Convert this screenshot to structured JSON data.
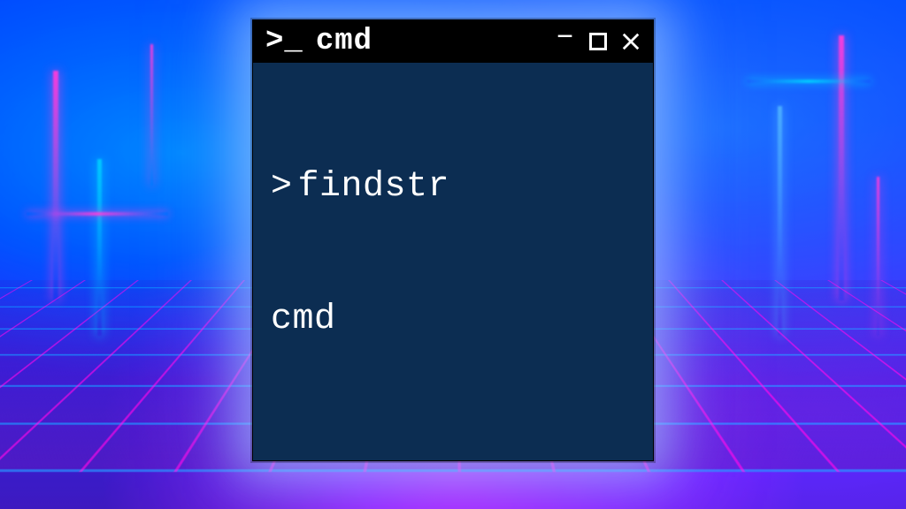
{
  "window": {
    "title": "cmd",
    "prompt_icon_glyph": ">_",
    "controls": {
      "minimize_glyph": "–",
      "close_glyph": "×"
    }
  },
  "terminal": {
    "prompt_symbol": ">",
    "command": "findstr",
    "output_line": "cmd"
  },
  "colors": {
    "titlebar_bg": "#000000",
    "terminal_bg": "#0c2d52",
    "text": "#ffffff"
  }
}
